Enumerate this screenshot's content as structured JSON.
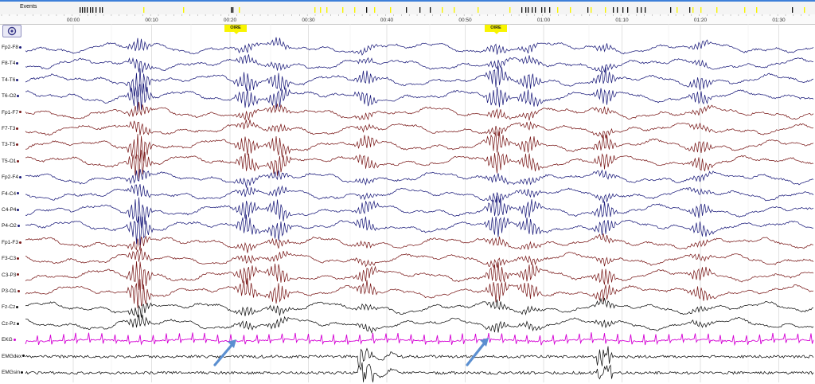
{
  "events_bar": {
    "label": "Events"
  },
  "time_ruler": {
    "ticks": [
      "00:00",
      "00:10",
      "00:20",
      "00:30",
      "00:40",
      "00:50",
      "01:00",
      "01:10",
      "01:20",
      "01:30"
    ]
  },
  "markers": [
    "OIRE",
    "OIRE"
  ],
  "channels": [
    {
      "label": "Fp2-F8",
      "color": "#1a1a7a"
    },
    {
      "label": "F8-T4",
      "color": "#1a1a7a"
    },
    {
      "label": "T4-T6",
      "color": "#1a1a7a"
    },
    {
      "label": "T6-O2",
      "color": "#1a1a7a"
    },
    {
      "label": "Fp1-F7",
      "color": "#7a1a1a"
    },
    {
      "label": "F7-T3",
      "color": "#7a1a1a"
    },
    {
      "label": "T3-T5",
      "color": "#7a1a1a"
    },
    {
      "label": "T5-O1",
      "color": "#7a1a1a"
    },
    {
      "label": "Fp2-F4",
      "color": "#1a1a7a"
    },
    {
      "label": "F4-C4",
      "color": "#1a1a7a"
    },
    {
      "label": "C4-P4",
      "color": "#1a1a7a"
    },
    {
      "label": "P4-O2",
      "color": "#1a1a7a"
    },
    {
      "label": "Fp1-F3",
      "color": "#7a1a1a"
    },
    {
      "label": "F3-C3",
      "color": "#7a1a1a"
    },
    {
      "label": "C3-P3",
      "color": "#7a1a1a"
    },
    {
      "label": "P3-O1",
      "color": "#7a1a1a"
    },
    {
      "label": "Fz-Cz",
      "color": "#111111"
    },
    {
      "label": "Cz-Pz",
      "color": "#111111"
    },
    {
      "label": "EKG",
      "color": "#d400d4"
    },
    {
      "label": "EMGdex",
      "color": "#111111"
    },
    {
      "label": "EMGsin",
      "color": "#111111"
    }
  ],
  "colors": {
    "event_yellow": "#f8f400",
    "arrow": "#5b8fd0",
    "grid": "#d6d6d6"
  },
  "icons": {
    "settings": "gear-icon",
    "arrow": "annotation-arrow-icon"
  }
}
